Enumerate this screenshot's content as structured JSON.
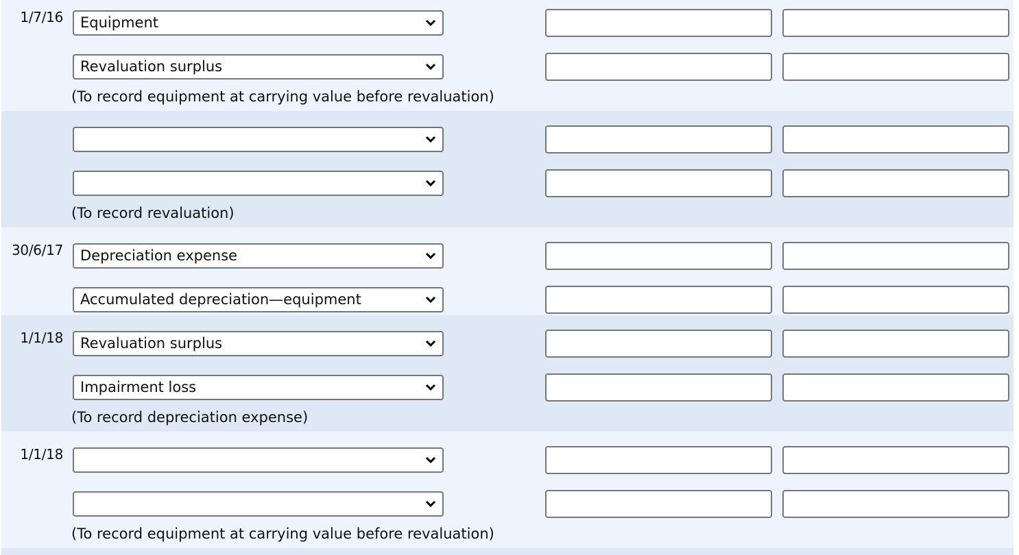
{
  "colors": {
    "entry_light_bg": "#edf4fe",
    "entry_dark_bg": "#dfe9f5",
    "field_border": "#767676"
  },
  "entries": [
    {
      "date": "1/7/16",
      "lines": [
        {
          "account": "Equipment",
          "debit": "",
          "credit": ""
        },
        {
          "account": "Revaluation surplus",
          "debit": "",
          "credit": ""
        }
      ],
      "memo": "(To record equipment at carrying value before revaluation)"
    },
    {
      "date": "",
      "lines": [
        {
          "account": "",
          "debit": "",
          "credit": ""
        },
        {
          "account": "",
          "debit": "",
          "credit": ""
        }
      ],
      "memo": "(To record revaluation)"
    },
    {
      "date": "30/6/17",
      "lines": [
        {
          "account": "Depreciation expense",
          "debit": "",
          "credit": ""
        },
        {
          "account": "Accumulated depreciation—equipment",
          "debit": "",
          "credit": ""
        }
      ],
      "memo": ""
    },
    {
      "date": "1/1/18",
      "lines": [
        {
          "account": "Revaluation surplus",
          "debit": "",
          "credit": ""
        },
        {
          "account": "Impairment loss",
          "debit": "",
          "credit": ""
        }
      ],
      "memo": "(To record depreciation expense)"
    },
    {
      "date": "1/1/18",
      "lines": [
        {
          "account": "",
          "debit": "",
          "credit": ""
        },
        {
          "account": "",
          "debit": "",
          "credit": ""
        }
      ],
      "memo": "(To record equipment at carrying value before revaluation)"
    }
  ],
  "icons": {
    "dropdown": "chevron-down-icon"
  }
}
